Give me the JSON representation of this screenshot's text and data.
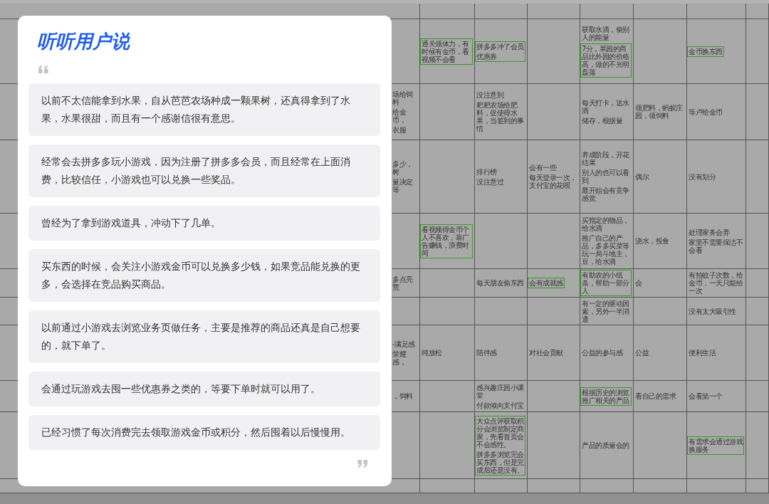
{
  "sheet": {
    "rows": [
      {
        "cells": [
          null,
          null,
          null,
          null,
          null,
          null,
          null
        ]
      },
      {
        "cells": [
          null,
          [
            {
              "lines": [
                "通关领体力，有时候有金币，看视频不会看"
              ],
              "highlighted": true
            }
          ],
          [
            {
              "lines": [
                "拼多多冲了会员",
                "优惠券"
              ],
              "highlighted": true
            }
          ],
          null,
          [
            {
              "lines": [
                "获取水滴，偷别人的能量"
              ],
              "highlighted": false
            },
            {
              "lines": [
                "7分，果园的商品比外园的价格高，做的不光明磊落"
              ],
              "highlighted": true
            }
          ],
          null,
          [
            {
              "lines": [
                "金币换东西"
              ],
              "highlighted": true
            }
          ]
        ]
      },
      {
        "cells": [
          [
            {
              "lines": [
                "场给饲料",
                "给金币，",
                "衣服"
              ],
              "highlighted": false
            }
          ],
          null,
          [
            {
              "lines": [
                "没注意到",
                "耙耙农场给肥料，促使得水果，当签到的事情"
              ],
              "highlighted": false
            }
          ],
          null,
          [
            {
              "lines": [
                "每天打卡，送水滴",
                "储存，根据量"
              ],
              "highlighted": false
            }
          ],
          [
            {
              "lines": [
                "领肥料，蚂蚁庄园，领饲料"
              ],
              "highlighted": false
            }
          ],
          [
            {
              "lines": [
                "等卢给金币"
              ],
              "highlighted": false
            }
          ]
        ]
      },
      {
        "cells": [
          [
            {
              "lines": [
                "多少，树",
                "量决定等"
              ],
              "highlighted": false
            }
          ],
          null,
          [
            {
              "lines": [
                "排行榜",
                "没注意过"
              ],
              "highlighted": false
            }
          ],
          [
            {
              "lines": [
                "会有一些",
                "每天登录一次，支付宝的花呗"
              ],
              "highlighted": false
            }
          ],
          [
            {
              "lines": [
                "养成阶段，开花结果",
                "别人的也可以看到",
                "最开始会有竞争感觉"
              ],
              "highlighted": false
            }
          ],
          [
            {
              "lines": [
                "偶尔"
              ],
              "highlighted": false
            }
          ],
          [
            {
              "lines": [
                "没有划分"
              ],
              "highlighted": false
            }
          ]
        ]
      },
      {
        "cells": [
          null,
          [
            {
              "lines": [
                "看视频得金币个人不喜欢，靠广告赚钱，浪费时间"
              ],
              "highlighted": true
            }
          ],
          null,
          null,
          [
            {
              "lines": [
                "买指定的物品，给水滴",
                "推广自己的产品，多多买菜等玩一局斗地主，豆，给水滴"
              ],
              "highlighted": false
            }
          ],
          [
            {
              "lines": [
                "浇水，投食"
              ],
              "highlighted": false
            }
          ],
          [
            {
              "lines": [
                "处理家务会弄",
                "家里不需要保洁不会看"
              ],
              "highlighted": false
            }
          ]
        ]
      },
      {
        "cells": [
          [
            {
              "lines": [
                "多点亮荒"
              ],
              "highlighted": false
            }
          ],
          null,
          [
            {
              "lines": [
                "每天朋友偷东西"
              ],
              "highlighted": false
            }
          ],
          [
            {
              "lines": [
                "会有成就感"
              ],
              "highlighted": true
            }
          ],
          [
            {
              "lines": [
                "有助农的小纸条，帮助一部分人"
              ],
              "highlighted": true
            }
          ],
          [
            {
              "lines": [
                "会"
              ],
              "highlighted": false
            }
          ],
          [
            {
              "lines": [
                "有拍蚊子次数，给金币，一天只能给一次"
              ],
              "highlighted": false
            }
          ]
        ]
      },
      {
        "cells": [
          null,
          null,
          null,
          null,
          [
            {
              "lines": [
                "有一定的驱动因素，另外一半消遣"
              ],
              "highlighted": false
            }
          ],
          null,
          [
            {
              "lines": [
                "没有太大吸引性"
              ],
              "highlighted": false
            }
          ]
        ]
      },
      {
        "cells": [
          [
            {
              "lines": [
                "-满足感",
                "荣耀感，"
              ],
              "highlighted": false
            }
          ],
          [
            {
              "lines": [
                "纯放松"
              ],
              "highlighted": false
            }
          ],
          [
            {
              "lines": [
                "陪伴感"
              ],
              "highlighted": false
            }
          ],
          [
            {
              "lines": [
                "对社会贡献"
              ],
              "highlighted": false
            }
          ],
          [
            {
              "lines": [
                "公益的参与感"
              ],
              "highlighted": false
            }
          ],
          [
            {
              "lines": [
                "公益"
              ],
              "highlighted": false
            }
          ],
          [
            {
              "lines": [
                "便利生活"
              ],
              "highlighted": false
            }
          ]
        ]
      },
      {
        "cells": [
          [
            {
              "lines": [
                "，饲料"
              ],
              "highlighted": false
            }
          ],
          null,
          [
            {
              "lines": [
                "感兴趣庄园小课堂",
                "付款倾向支付宝"
              ],
              "highlighted": false
            }
          ],
          null,
          [
            {
              "lines": [
                "根据历史的浏览推广相关的产品"
              ],
              "highlighted": true
            }
          ],
          [
            {
              "lines": [
                "看自己的需求"
              ],
              "highlighted": false
            }
          ],
          [
            {
              "lines": [
                "会看第一个"
              ],
              "highlighted": false
            }
          ]
        ]
      },
      {
        "cells": [
          null,
          null,
          [
            {
              "lines": [
                "大众点评获取积分会浏览制定商家，先看首页会不会感性。",
                "拼多多浏览完会买东西，但是完成后还是没有。"
              ],
              "highlighted": true
            }
          ],
          null,
          [
            {
              "lines": [
                "产品的质量会的"
              ],
              "highlighted": false
            }
          ],
          null,
          [
            {
              "lines": [
                "有需求会通过游戏换服务"
              ],
              "highlighted": true
            }
          ]
        ]
      },
      {
        "cells": [
          null,
          null,
          null,
          null,
          null,
          null,
          null
        ]
      }
    ]
  },
  "dialog": {
    "title": "听听用户说",
    "quotes": [
      "以前不太信能拿到水果，自从芭芭农场种成一颗果树，还真得拿到了水果，水果很甜，而且有一个感谢信很有意思。",
      "经常会去拼多多玩小游戏，因为注册了拼多多会员，而且经常在上面消费，比较信任，小游戏也可以兑换一些奖品。",
      "曾经为了拿到游戏道具，冲动下了几单。",
      "买东西的时候，会关注小游戏金币可以兑换多少钱，如果竞品能兑换的更多，会选择在竞品购买商品。",
      "以前通过小游戏去浏览业务页做任务，主要是推荐的商品还真是自己想要的，就下单了。",
      "会通过玩游戏去囤一些优惠券之类的，等要下单时就可以用了。",
      "已经习惯了每次消费完去领取游戏金币或积分，然后囤着以后慢慢用。"
    ]
  }
}
